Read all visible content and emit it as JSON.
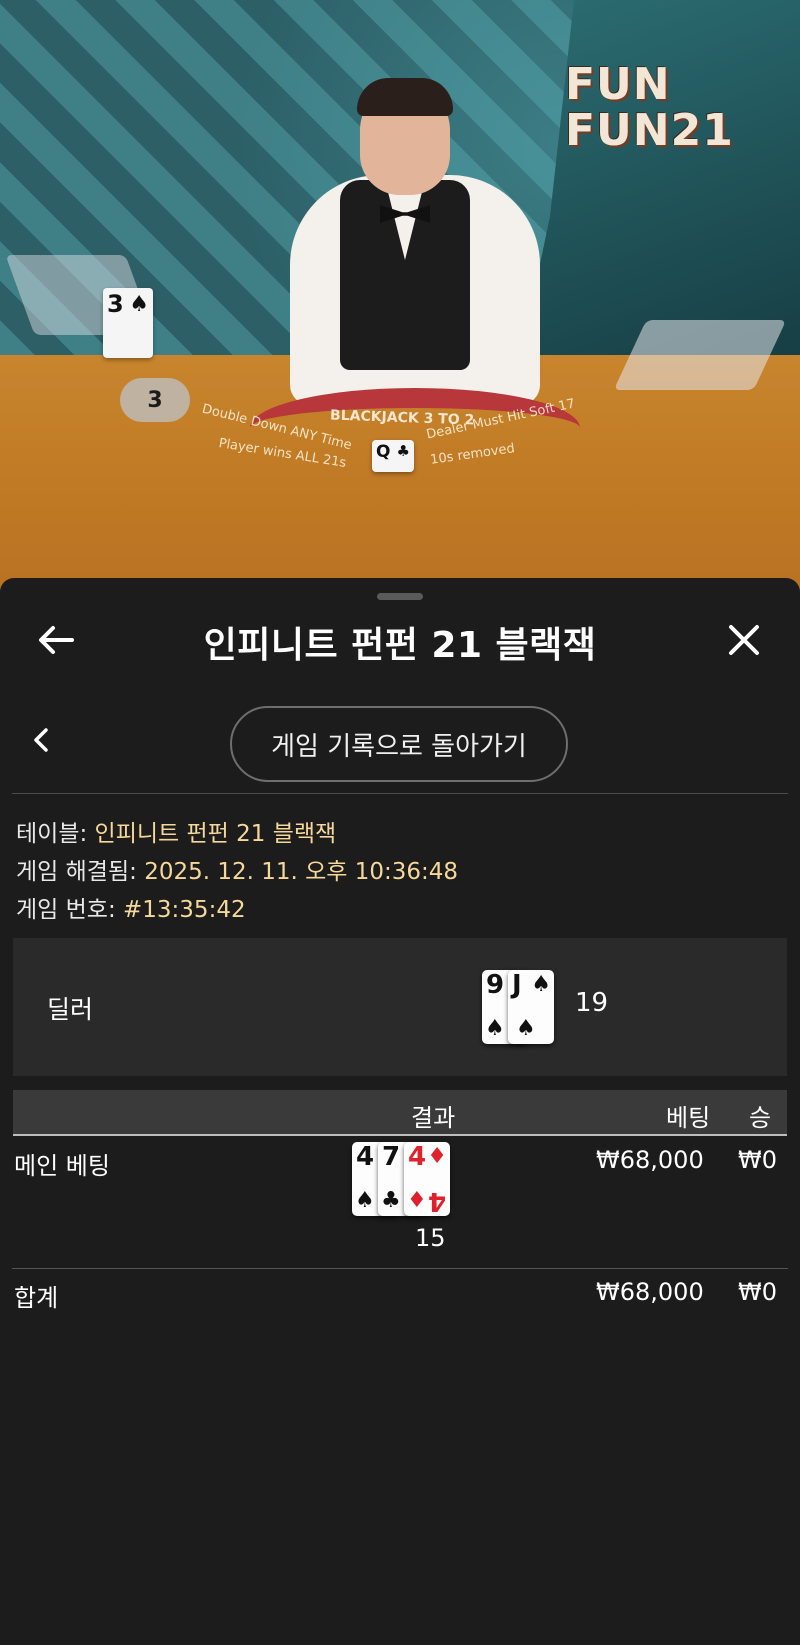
{
  "video": {
    "logo_line1": "FUN",
    "logo_line2": "FUN21",
    "felt_arc": "BLACKJACK 3 TO 2",
    "felt_left1": "Double Down ANY Time",
    "felt_left2": "Player wins ALL 21s",
    "felt_right1": "Dealer Must Hit Soft 17",
    "felt_right2": "10s removed",
    "discard_card": {
      "rank": "3",
      "suit": "♠"
    },
    "dealer_felt_card": {
      "rank": "Q",
      "suit": "♣"
    },
    "shoe_count": "3"
  },
  "sheet": {
    "title": "인피니트 펀펀 21 블랙잭",
    "back_icon": "arrow-left-icon",
    "close_icon": "close-icon",
    "history_button": "게임 기록으로 돌아가기",
    "info": {
      "table_label": "테이블:",
      "table_value": "인피니트 펀펀 21 블랙잭",
      "resolved_label": "게임 해결됨:",
      "resolved_value": "2025. 12. 11. 오후 10:36:48",
      "number_label": "게임 번호:",
      "number_value": "#13:35:42"
    },
    "dealer": {
      "label": "딜러",
      "cards": [
        {
          "rank": "9",
          "suit": "♠",
          "color": "black"
        },
        {
          "rank": "J",
          "suit": "♠",
          "color": "black"
        }
      ],
      "score": "19"
    },
    "columns": {
      "result": "결과",
      "bet": "베팅",
      "win": "승"
    },
    "rows": [
      {
        "label": "메인 베팅",
        "cards": [
          {
            "rank": "4",
            "suit": "♠",
            "color": "black"
          },
          {
            "rank": "7",
            "suit": "♣",
            "color": "black"
          },
          {
            "rank": "4",
            "suit": "♦",
            "color": "red"
          }
        ],
        "score": "15",
        "bet": "₩68,000",
        "win": "₩0"
      }
    ],
    "total": {
      "label": "합계",
      "bet": "₩68,000",
      "win": "₩0"
    }
  }
}
